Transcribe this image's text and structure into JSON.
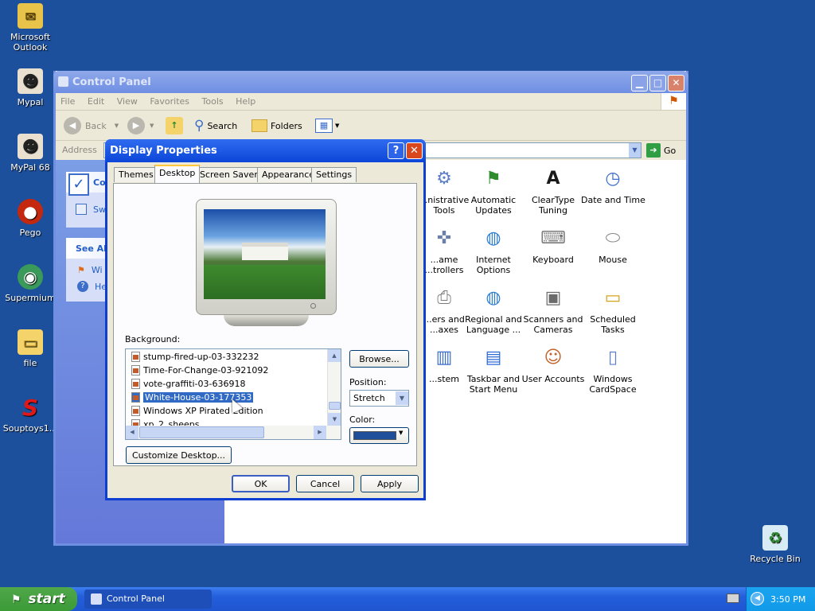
{
  "desktop": {
    "icons": [
      {
        "label": "Microsoft Outlook",
        "icon": "outlook-icon"
      },
      {
        "label": "Mypal",
        "icon": "raccoon-icon"
      },
      {
        "label": "MyPal 68",
        "icon": "raccoon-icon"
      },
      {
        "label": "Pego",
        "icon": "pego-icon"
      },
      {
        "label": "Supermium",
        "icon": "supermium-icon"
      },
      {
        "label": "file",
        "icon": "folder-icon"
      },
      {
        "label": "Souptoys1...",
        "icon": "souptoys-icon"
      },
      {
        "label": "Recycle Bin",
        "icon": "recycle-bin-icon"
      }
    ]
  },
  "control_panel": {
    "title": "Control Panel",
    "menu": [
      "File",
      "Edit",
      "View",
      "Favorites",
      "Tools",
      "Help"
    ],
    "toolbar": {
      "back": "Back",
      "search": "Search",
      "folders": "Folders"
    },
    "address_label": "Address",
    "go_label": "Go",
    "taskpane": {
      "panel1_title": "Cont",
      "switch_link": "Sw",
      "see_also": "See Als",
      "link1": "Wi",
      "link2": "He"
    },
    "items": [
      {
        "label": "...nistrative\nTools"
      },
      {
        "label": "Automatic\nUpdates"
      },
      {
        "label": "ClearType\nTuning"
      },
      {
        "label": "Date and Time"
      },
      {
        "label": "...ame\n...trollers"
      },
      {
        "label": "Internet\nOptions"
      },
      {
        "label": "Keyboard"
      },
      {
        "label": "Mouse"
      },
      {
        "label": "...ers and\n...axes"
      },
      {
        "label": "Regional and\nLanguage ..."
      },
      {
        "label": "Scanners and\nCameras"
      },
      {
        "label": "Scheduled\nTasks"
      },
      {
        "label": "...stem"
      },
      {
        "label": "Taskbar and\nStart Menu"
      },
      {
        "label": "User Accounts"
      },
      {
        "label": "Windows\nCardSpace"
      }
    ]
  },
  "dialog": {
    "title": "Display Properties",
    "tabs": [
      "Themes",
      "Desktop",
      "Screen Saver",
      "Appearance",
      "Settings"
    ],
    "active_tab": "Desktop",
    "background_label": "Background:",
    "background_items": [
      "stump-fired-up-03-332232",
      "Time-For-Change-03-921092",
      "vote-graffiti-03-636918",
      "White-House-03-177353",
      "Windows XP Pirated Edition",
      "xp_2_sheeps"
    ],
    "selected_background": "White-House-03-177353",
    "browse_label": "Browse...",
    "position_label": "Position:",
    "position_value": "Stretch",
    "color_label": "Color:",
    "color_value": "#1f4e9a",
    "customize_label": "Customize Desktop...",
    "ok_label": "OK",
    "cancel_label": "Cancel",
    "apply_label": "Apply"
  },
  "taskbar": {
    "start_label": "start",
    "task_label": "Control Panel",
    "clock": "3:50 PM"
  }
}
